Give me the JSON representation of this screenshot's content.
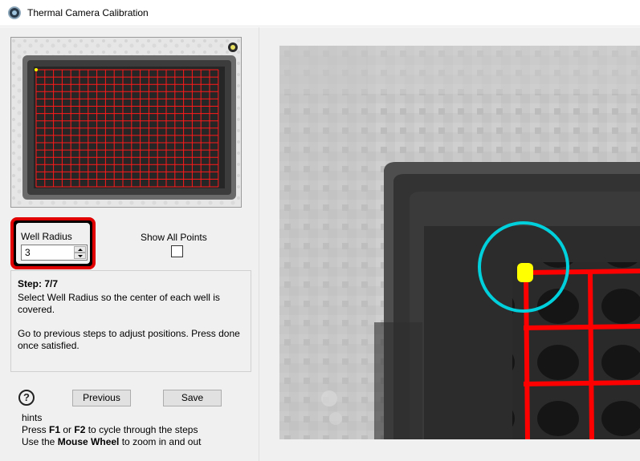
{
  "window": {
    "title": "Thermal Camera Calibration"
  },
  "well_radius": {
    "label": "Well Radius",
    "value": "3"
  },
  "show_all_points": {
    "label": "Show All Points",
    "checked": false
  },
  "step": {
    "title": "Step: 7/7",
    "text1": "Select Well Radius so the center of each well is covered.",
    "text2": "Go to previous steps to adjust positions. Press done once satisfied."
  },
  "buttons": {
    "help": "?",
    "previous": "Previous",
    "save": "Save"
  },
  "hints": {
    "title": "hints",
    "line1": {
      "prefix": "Press ",
      "key1": "F1",
      "mid": " or ",
      "key2": "F2",
      "suffix": " to cycle through the steps"
    },
    "line2": {
      "prefix": "Use the ",
      "key": "Mouse Wheel",
      "suffix": " to zoom in and out"
    }
  },
  "colors": {
    "grid": "#ff0000",
    "highlight_border": "#e00000",
    "selection_circle": "#00d0dc",
    "selected_point": "#ffff00"
  }
}
